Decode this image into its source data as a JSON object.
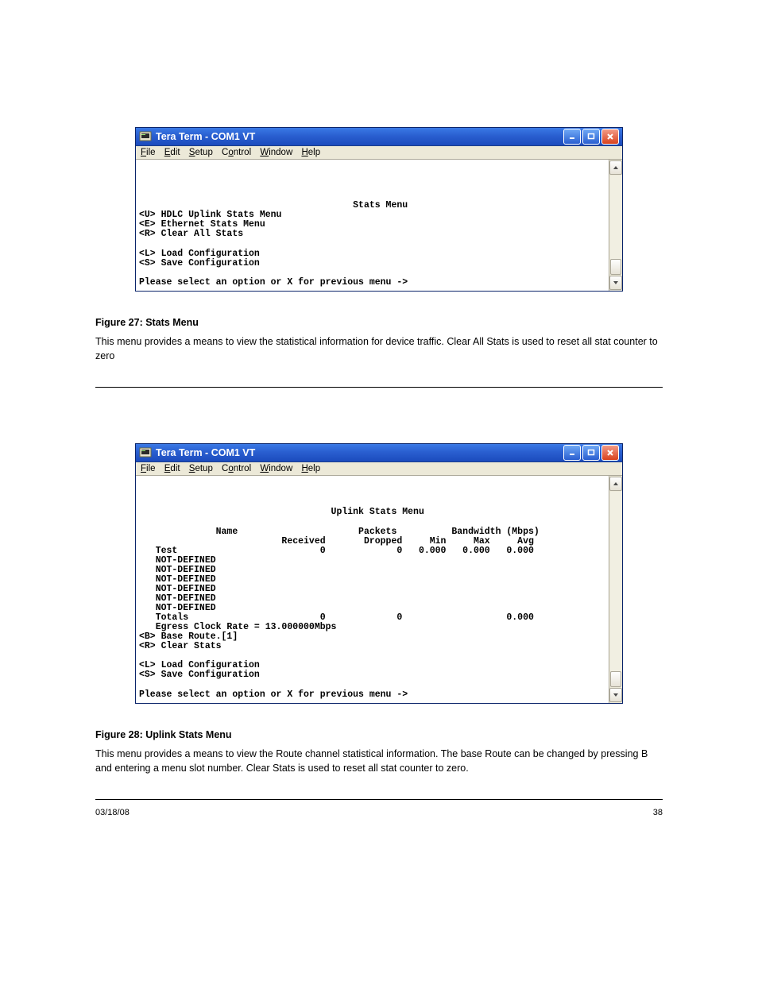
{
  "window1": {
    "title": "Tera Term - COM1 VT",
    "menu": [
      "File",
      "Edit",
      "Setup",
      "Control",
      "Window",
      "Help"
    ],
    "menu_ul": [
      "F",
      "E",
      "S",
      "o",
      "W",
      "H"
    ],
    "terminal_lines": [
      "",
      "",
      "",
      "",
      "                                       Stats Menu",
      "<U> HDLC Uplink Stats Menu",
      "<E> Ethernet Stats Menu",
      "<R> Clear All Stats",
      "",
      "<L> Load Configuration",
      "<S> Save Configuration",
      "",
      "Please select an option or X for previous menu ->"
    ]
  },
  "caption1": {
    "title": "Figure 27: Stats Menu",
    "text": "This menu provides a means to view the statistical information for device traffic. Clear All Stats is used to reset all stat counter to zero"
  },
  "window2": {
    "title": "Tera Term - COM1 VT",
    "menu": [
      "File",
      "Edit",
      "Setup",
      "Control",
      "Window",
      "Help"
    ],
    "menu_ul": [
      "F",
      "E",
      "S",
      "o",
      "W",
      "H"
    ],
    "terminal_lines": [
      "",
      "",
      "",
      "                                   Uplink Stats Menu",
      "",
      "              Name                      Packets          Bandwidth (Mbps)",
      "                          Received       Dropped     Min     Max     Avg",
      "   Test                          0             0   0.000   0.000   0.000",
      "   NOT-DEFINED",
      "   NOT-DEFINED",
      "   NOT-DEFINED",
      "   NOT-DEFINED",
      "   NOT-DEFINED",
      "   NOT-DEFINED",
      "   Totals                        0             0                   0.000",
      "   Egress Clock Rate = 13.000000Mbps",
      "<B> Base Route.[1]",
      "<R> Clear Stats",
      "",
      "<L> Load Configuration",
      "<S> Save Configuration",
      "",
      "Please select an option or X for previous menu ->"
    ],
    "chart_data": {
      "type": "table",
      "title": "Uplink Stats Menu",
      "group_headers": [
        "Name",
        "Packets",
        "Bandwidth (Mbps)"
      ],
      "columns": [
        "Name",
        "Received",
        "Dropped",
        "Min",
        "Max",
        "Avg"
      ],
      "rows": [
        {
          "Name": "Test",
          "Received": 0,
          "Dropped": 0,
          "Min": 0.0,
          "Max": 0.0,
          "Avg": 0.0
        },
        {
          "Name": "NOT-DEFINED"
        },
        {
          "Name": "NOT-DEFINED"
        },
        {
          "Name": "NOT-DEFINED"
        },
        {
          "Name": "NOT-DEFINED"
        },
        {
          "Name": "NOT-DEFINED"
        },
        {
          "Name": "NOT-DEFINED"
        }
      ],
      "totals": {
        "Received": 0,
        "Dropped": 0,
        "Avg": 0.0
      },
      "egress_clock_rate_mbps": 13.0
    }
  },
  "caption2": {
    "title": "Figure 28: Uplink Stats Menu",
    "text": "This menu provides a means to view the Route channel statistical information. The base Route can be changed by pressing B and entering a menu slot number. Clear Stats is used to reset all stat counter to zero."
  },
  "footer": {
    "left": "03/18/08",
    "right": "38"
  }
}
